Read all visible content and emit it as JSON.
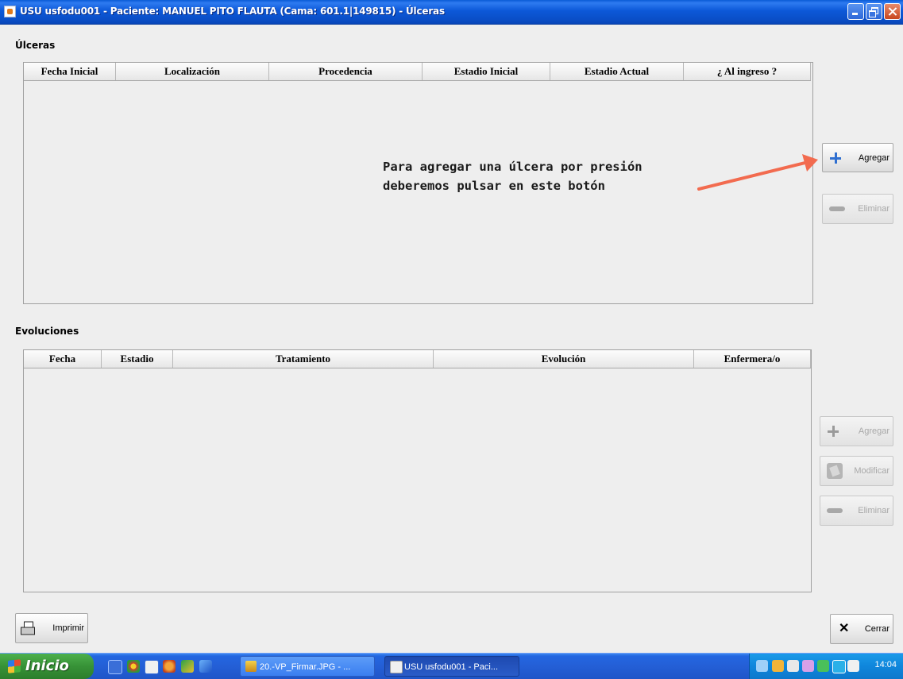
{
  "window": {
    "title": "USU usfodu001 - Paciente: MANUEL PITO FLAUTA (Cama: 601.1|149815) - Úlceras"
  },
  "ulceras": {
    "section_label": "Úlceras",
    "columns": [
      "Fecha Inicial",
      "Localización",
      "Procedencia",
      "Estadio Inicial",
      "Estadio Actual",
      "¿ Al ingreso ?"
    ],
    "rows": [],
    "add_button": "Agregar",
    "delete_button": "Eliminar"
  },
  "evoluciones": {
    "section_label": "Evoluciones",
    "columns": [
      "Fecha",
      "Estadio",
      "Tratamiento",
      "Evolución",
      "Enfermera/o"
    ],
    "rows": [],
    "add_button": "Agregar",
    "modify_button": "Modificar",
    "delete_button": "Eliminar"
  },
  "annotation": {
    "line1": "Para agregar una úlcera por presión",
    "line2": "deberemos pulsar en este botón",
    "arrow_color": "#f26b4f"
  },
  "footer": {
    "print_button": "Imprimir",
    "close_button": "Cerrar"
  },
  "taskbar": {
    "start_label": "Inicio",
    "tasks": [
      "20.-VP_Firmar.JPG - ...",
      "USU usfodu001 - Paci..."
    ],
    "clock": "14:04"
  }
}
